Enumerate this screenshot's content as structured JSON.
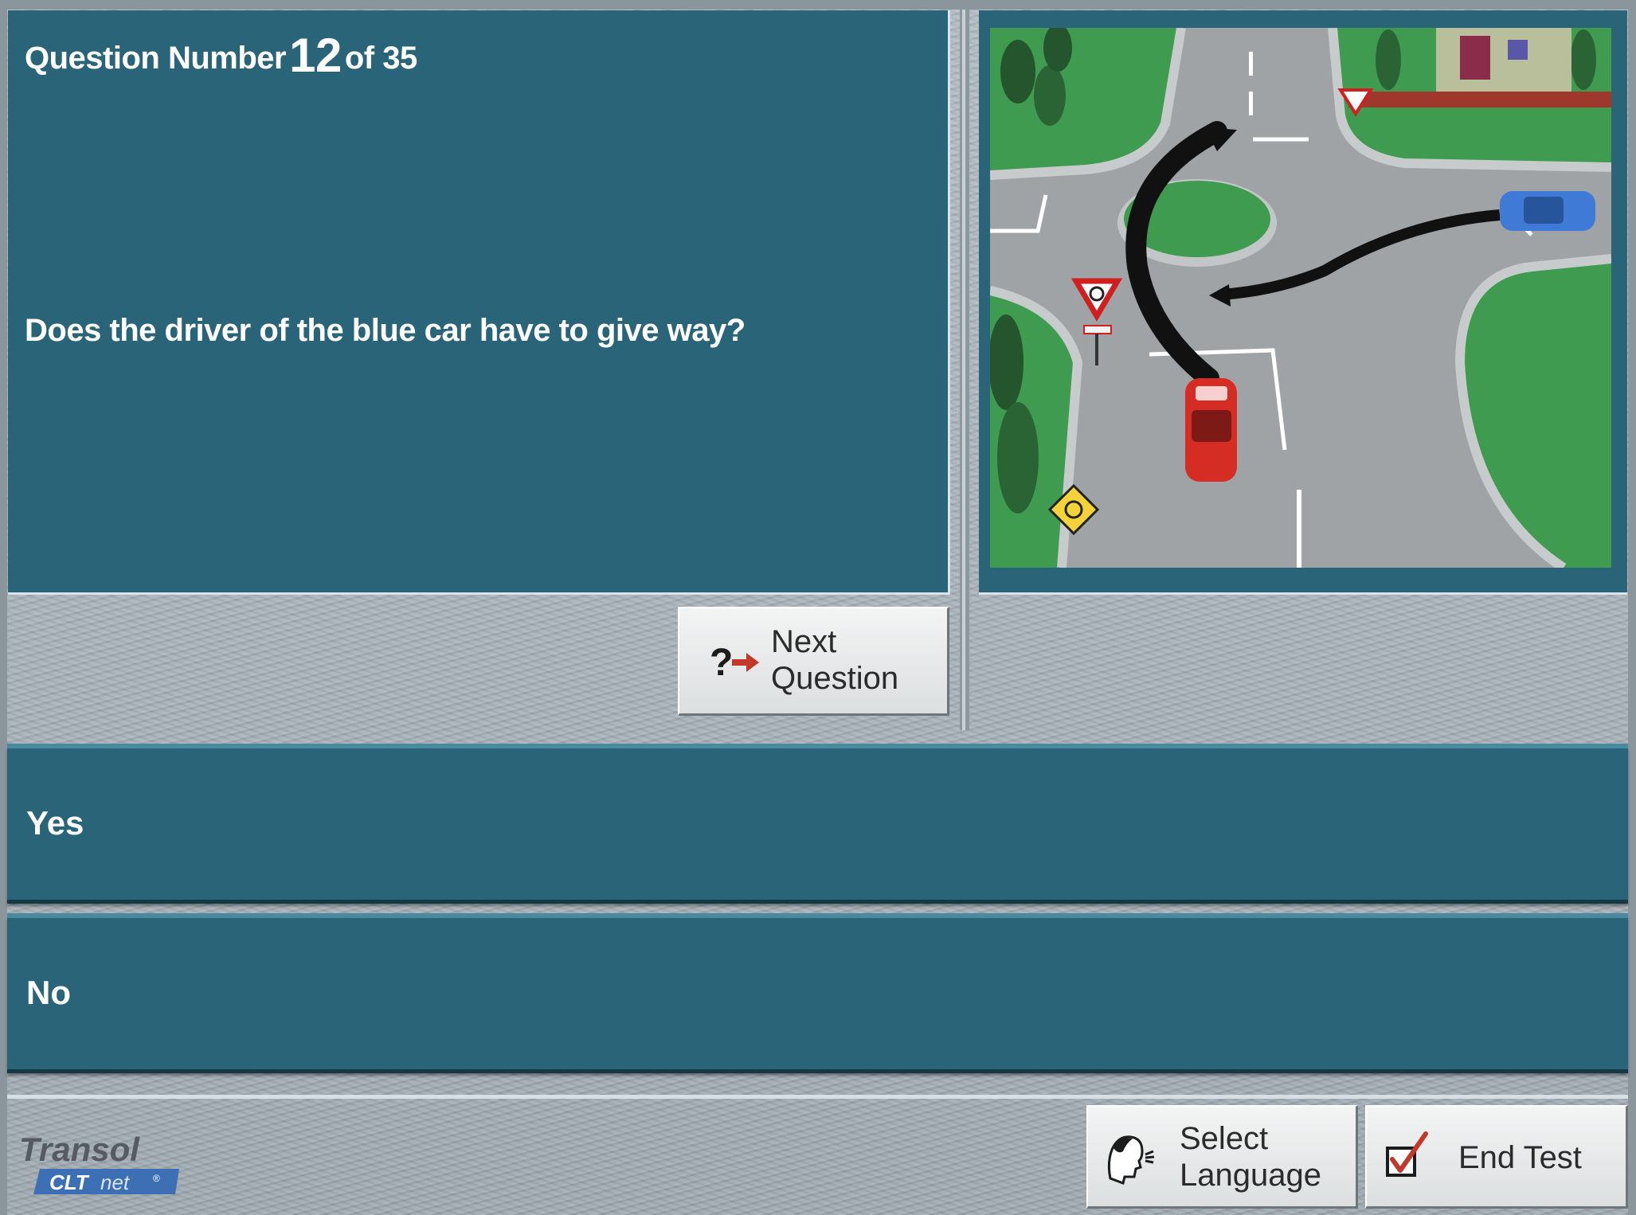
{
  "question": {
    "prefix": "Question Number",
    "number": "12",
    "suffix": "of 35",
    "text": "Does the driver of the blue car have to give way?"
  },
  "buttons": {
    "next_line1": "Next",
    "next_line2": "Question",
    "language_line1": "Select",
    "language_line2": "Language",
    "end_test": "End Test"
  },
  "answers": [
    {
      "label": "Yes"
    },
    {
      "label": "No"
    }
  ],
  "logo": {
    "brand": "Transol",
    "product_bold": "CLT",
    "product_light": "net",
    "mark": "®"
  },
  "colors": {
    "panel": "#2a6479",
    "background": "#a9b3b9",
    "button": "#e6e8e9",
    "arrow_red": "#c0392b"
  },
  "icons": {
    "next": "question-arrow-icon",
    "language": "speaking-head-icon",
    "end": "checkbox-tick-icon",
    "scene": "roundabout-illustration"
  }
}
